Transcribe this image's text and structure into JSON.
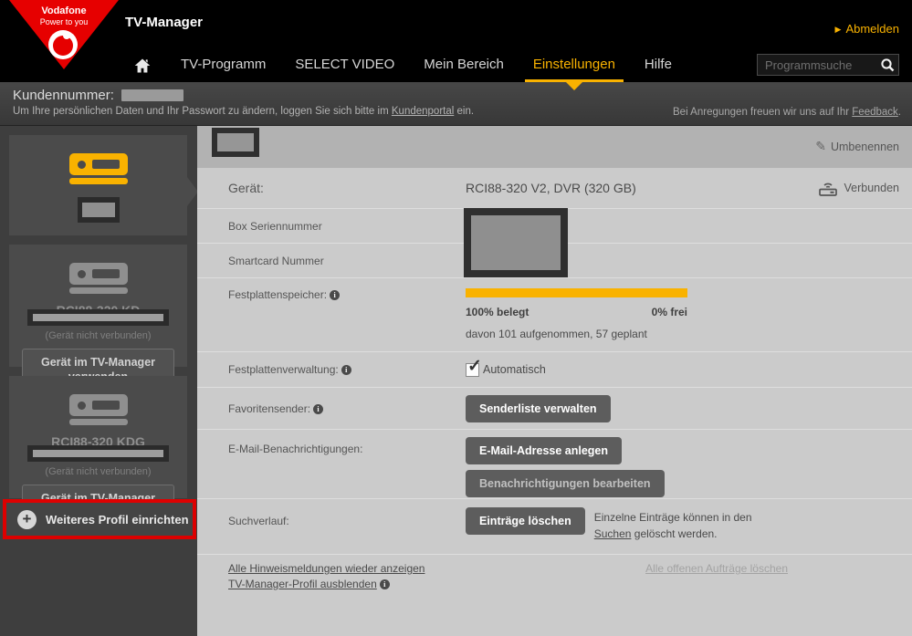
{
  "colors": {
    "accent": "#f9b200",
    "brand_red": "#e60000",
    "highlight_red": "#dd0000",
    "header_bg": "#000000",
    "content_bg": "#cbcbcb"
  },
  "icons": {
    "info": "i",
    "pencil": "✎",
    "check": "✓",
    "plus": "+",
    "arrow_right": "▶"
  },
  "header": {
    "logo": {
      "brand": "Vodafone",
      "tagline": "Power to you"
    },
    "app_title": "TV-Manager",
    "logout_label": "Abmelden",
    "nav": [
      {
        "label": "TV-Programm"
      },
      {
        "label": "SELECT VIDEO"
      },
      {
        "label": "Mein Bereich"
      },
      {
        "label": "Einstellungen"
      },
      {
        "label": "Hilfe"
      }
    ],
    "search_placeholder": "Programmsuche"
  },
  "subheader": {
    "customer_label": "Kundennummer:",
    "info_text_before": "Um Ihre persönlichen Daten und Ihr Passwort zu ändern, loggen Sie sich bitte im",
    "info_link": "Kundenportal",
    "info_text_after": "ein.",
    "feedback_text_before": "Bei Anregungen freuen wir uns auf Ihr",
    "feedback_link": "Feedback",
    "feedback_text_after": "."
  },
  "sidebar": {
    "devices": [
      {
        "selected": true
      },
      {
        "model": "RCI88-320 KD",
        "status": "(Gerät nicht verbunden)",
        "action_label": "Gerät im TV-Manager verwenden"
      },
      {
        "model": "RCI88-320 KDG",
        "status": "(Gerät nicht verbunden)",
        "action_label": "Gerät im TV-Manager verwenden"
      }
    ],
    "add_profile_label": "Weiteres Profil einrichten"
  },
  "content": {
    "rename_label": "Umbenennen",
    "geraet_label": "Gerät:",
    "geraet_value": "RCI88-320 V2, DVR (320 GB)",
    "connected_label": "Verbunden",
    "serial_label": "Box Seriennummer",
    "smartcard_label": "Smartcard Nummer",
    "storage": {
      "label": "Festplattenspeicher:",
      "percent_used": 100,
      "used_label": "100% belegt",
      "free_label": "0% frei",
      "detail": "davon 101 aufgenommen, 57 geplant"
    },
    "management": {
      "label": "Festplattenverwaltung:",
      "checkbox_label": "Automatisch",
      "checked": true
    },
    "favorites": {
      "label": "Favoritensender:",
      "button_label": "Senderliste verwalten"
    },
    "email": {
      "label": "E-Mail-Benachrichtigungen:",
      "button_create_label": "E-Mail-Adresse anlegen",
      "button_edit_label": "Benachrichtigungen bearbeiten"
    },
    "search_history": {
      "label": "Suchverlauf:",
      "button_label": "Einträge löschen",
      "note_before": "Einzelne Einträge können in den",
      "note_link": "Suchen",
      "note_after": "gelöscht werden."
    },
    "footer_links": {
      "show_hints": "Alle Hinweismeldungen wieder anzeigen",
      "hide_profile": "TV-Manager-Profil ausblenden",
      "delete_jobs": "Alle offenen Aufträge löschen"
    }
  }
}
